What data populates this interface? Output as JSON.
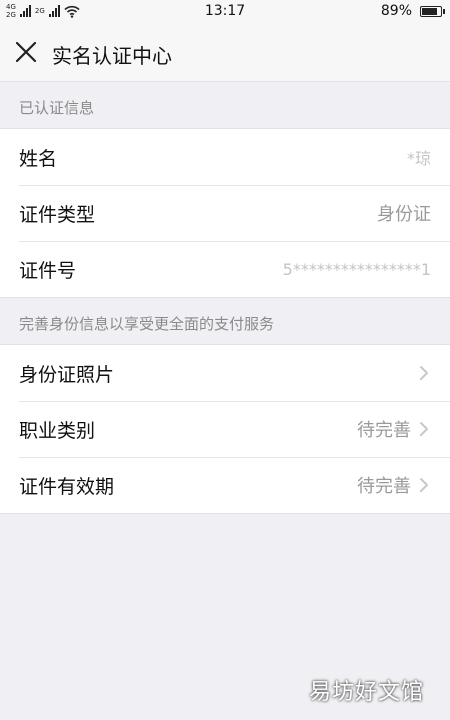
{
  "status_bar": {
    "network_top": "4G",
    "network_bottom": "2G",
    "network_right": "2G",
    "time": "13:17",
    "battery_percent_text": "89%",
    "battery_level": 0.89
  },
  "nav": {
    "close_icon": "close-icon",
    "title": "实名认证中心"
  },
  "verified_section": {
    "header": "已认证信息",
    "rows": [
      {
        "label": "姓名",
        "value": "*琼"
      },
      {
        "label": "证件类型",
        "value": "身份证"
      },
      {
        "label": "证件号",
        "value": "5****************1"
      }
    ]
  },
  "improve_section": {
    "header": "完善身份信息以享受更全面的支付服务",
    "rows": [
      {
        "label": "身份证照片",
        "value": ""
      },
      {
        "label": "职业类别",
        "value": "待完善"
      },
      {
        "label": "证件有效期",
        "value": "待完善"
      }
    ]
  },
  "watermark": "易坊好文馆",
  "colors": {
    "background": "#efeff4",
    "card": "#ffffff",
    "secondary_text": "#9a9a9a",
    "chevron": "#c7c7cc"
  }
}
